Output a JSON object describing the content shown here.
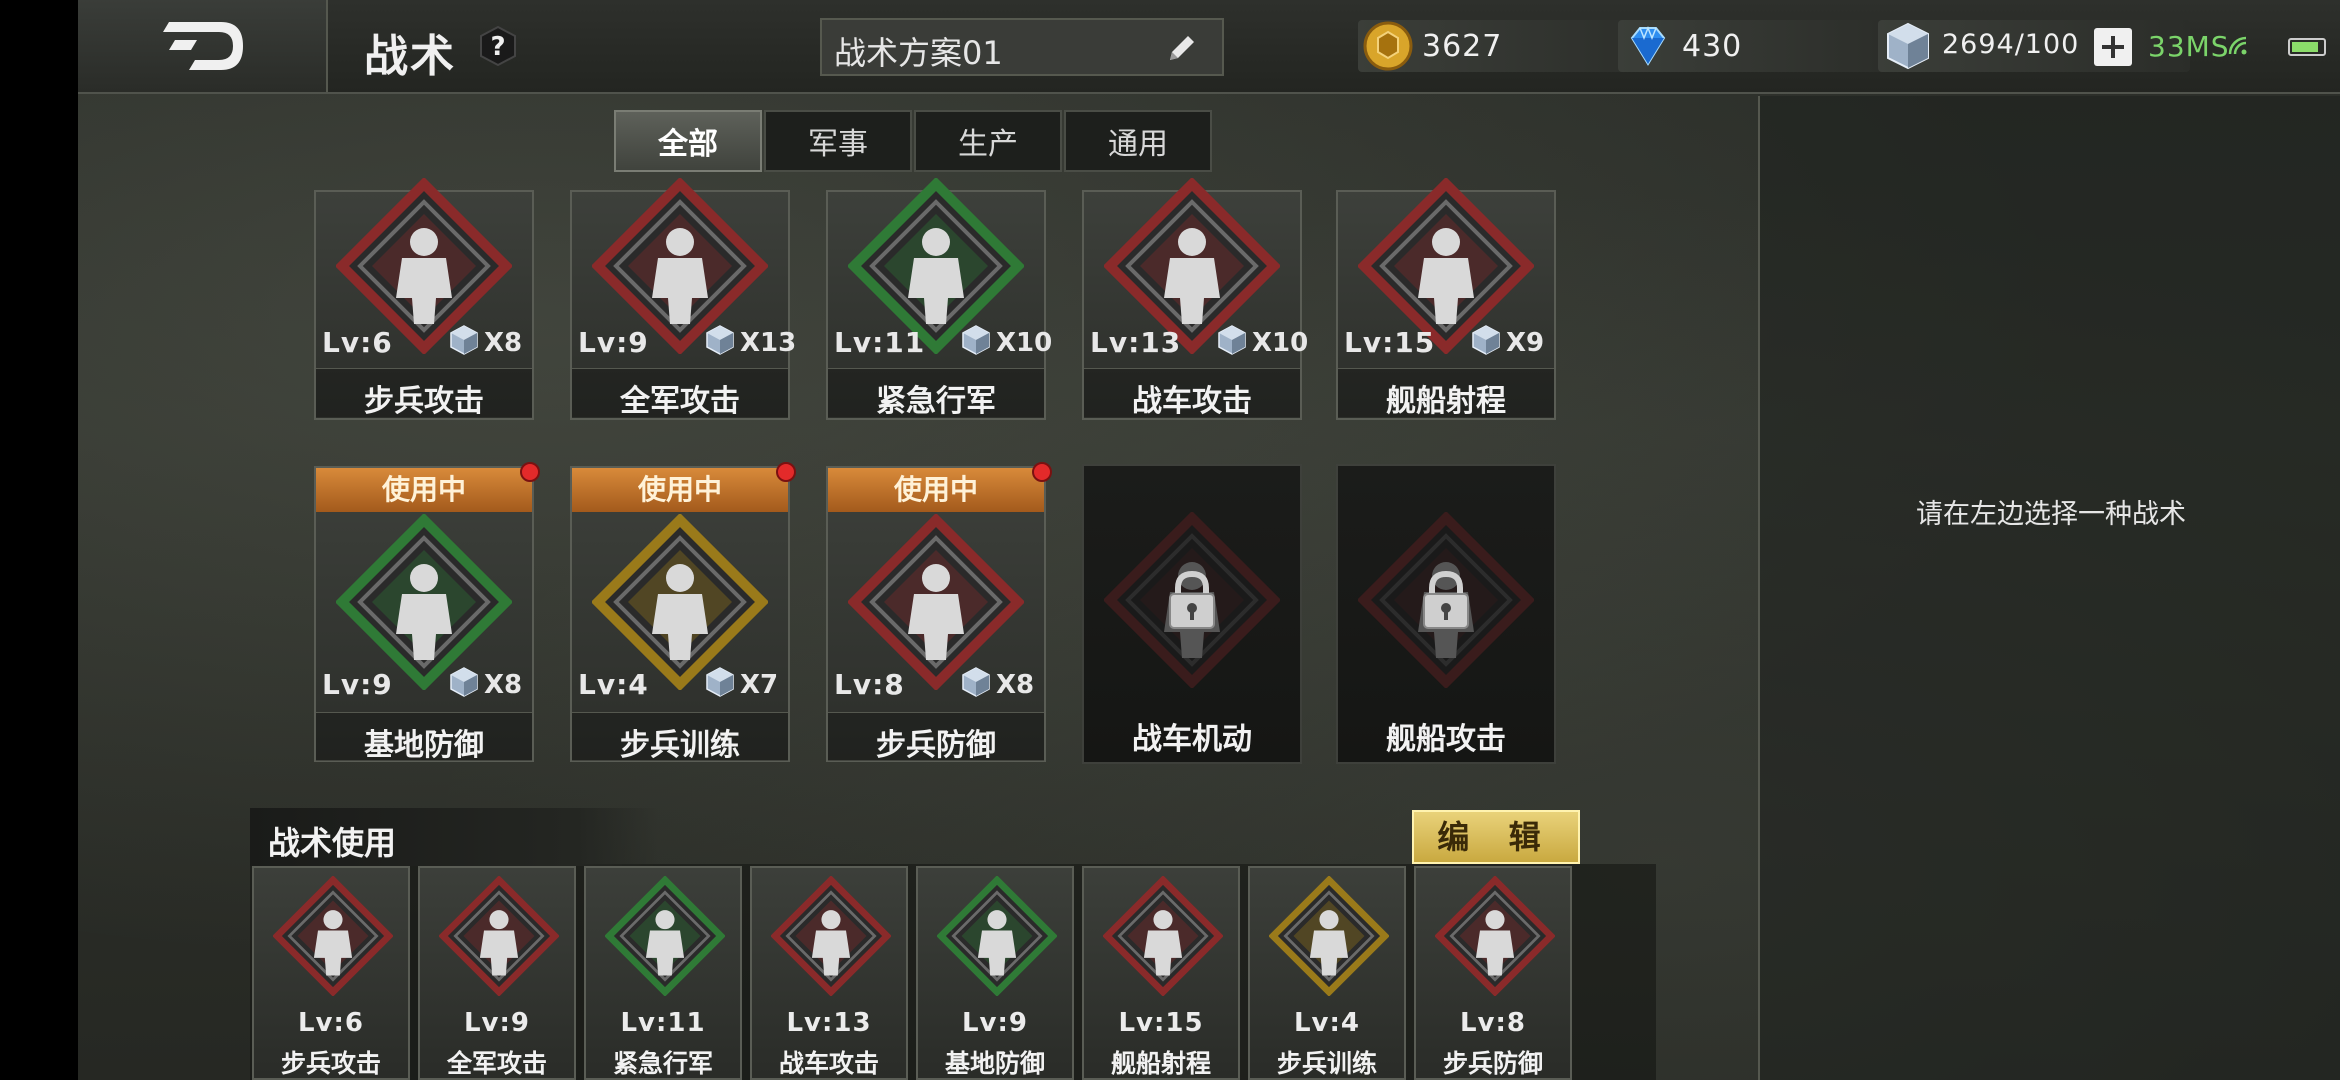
{
  "header": {
    "title": "战术",
    "plan_name": "战术方案01",
    "gold": "3627",
    "diamonds": "430",
    "crystal": "2694/100",
    "ping": "33MS"
  },
  "tabs": [
    "全部",
    "军事",
    "生产",
    "通用"
  ],
  "active_tab": "全部",
  "cards": [
    {
      "name": "步兵攻击",
      "lv": "Lv:6",
      "cost": "X8",
      "color": "#8a2a2a"
    },
    {
      "name": "全军攻击",
      "lv": "Lv:9",
      "cost": "X13",
      "color": "#8a2a2a"
    },
    {
      "name": "紧急行军",
      "lv": "Lv:11",
      "cost": "X10",
      "color": "#2f7a36"
    },
    {
      "name": "战车攻击",
      "lv": "Lv:13",
      "cost": "X10",
      "color": "#8a2a2a"
    },
    {
      "name": "舰船射程",
      "lv": "Lv:15",
      "cost": "X9",
      "color": "#8a2a2a"
    },
    {
      "name": "基地防御",
      "lv": "Lv:9",
      "cost": "X8",
      "color": "#2f7a36",
      "status": "使用中"
    },
    {
      "name": "步兵训练",
      "lv": "Lv:4",
      "cost": "X7",
      "color": "#9a7a1a",
      "status": "使用中"
    },
    {
      "name": "步兵防御",
      "lv": "Lv:8",
      "cost": "X8",
      "color": "#8a2a2a",
      "status": "使用中"
    },
    {
      "name": "战车机动",
      "locked": true
    },
    {
      "name": "舰船攻击",
      "locked": true
    }
  ],
  "right_panel": {
    "hint": "请在左边选择一种战术"
  },
  "usage": {
    "title": "战术使用",
    "edit_label": "编 辑",
    "slots": [
      {
        "lv": "Lv:6",
        "name": "步兵攻击",
        "color": "#8a2a2a"
      },
      {
        "lv": "Lv:9",
        "name": "全军攻击",
        "color": "#8a2a2a"
      },
      {
        "lv": "Lv:11",
        "name": "紧急行军",
        "color": "#2f7a36"
      },
      {
        "lv": "Lv:13",
        "name": "战车攻击",
        "color": "#8a2a2a"
      },
      {
        "lv": "Lv:9",
        "name": "基地防御",
        "color": "#2f7a36"
      },
      {
        "lv": "Lv:15",
        "name": "舰船射程",
        "color": "#8a2a2a"
      },
      {
        "lv": "Lv:4",
        "name": "步兵训练",
        "color": "#9a7a1a"
      },
      {
        "lv": "Lv:8",
        "name": "步兵防御",
        "color": "#8a2a2a"
      }
    ]
  }
}
